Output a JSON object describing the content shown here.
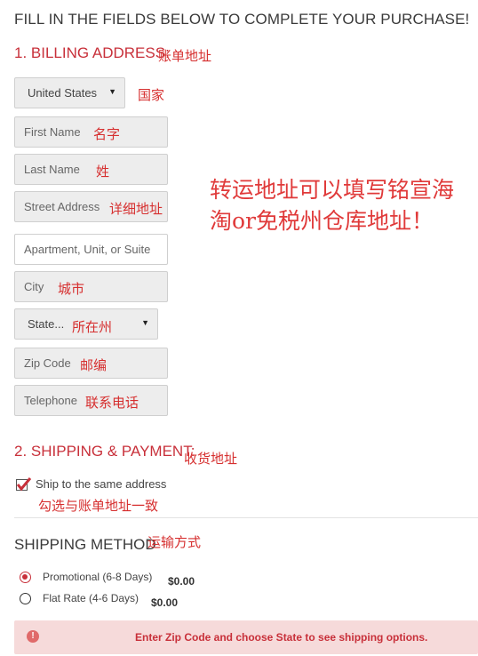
{
  "header": {
    "title": "FILL IN THE FIELDS BELOW TO COMPLETE YOUR PURCHASE!"
  },
  "billing": {
    "heading": "1. BILLING ADDRESS:",
    "note": "账单地址",
    "country": {
      "value": "United States",
      "note": "国家"
    },
    "first_name": {
      "placeholder": "First Name",
      "note": "名字"
    },
    "last_name": {
      "placeholder": "Last Name",
      "note": "姓"
    },
    "street": {
      "placeholder": "Street Address",
      "note": "详细地址"
    },
    "apartment": {
      "placeholder": "Apartment, Unit, or Suite"
    },
    "city": {
      "placeholder": "City",
      "note": "城市"
    },
    "state": {
      "value": "State...",
      "note": "所在州"
    },
    "zip": {
      "placeholder": "Zip Code",
      "note": "邮编"
    },
    "telephone": {
      "placeholder": "Telephone",
      "note": "联系电话"
    }
  },
  "annotation": {
    "text": "转运地址可以填写铭宣海淘or免税州仓库地址！"
  },
  "shipping_payment": {
    "heading": "2. SHIPPING & PAYMENT:",
    "note": "收货地址",
    "same_address": {
      "label": "Ship to the same address",
      "checked": true,
      "note": "勾选与账单地址一致"
    }
  },
  "shipping_method": {
    "heading": "SHIPPING METHOD",
    "note": "运输方式",
    "options": [
      {
        "label": "Promotional (6-8 Days)",
        "price": "$0.00",
        "selected": true
      },
      {
        "label": "Flat Rate (4-6 Days)",
        "price": "$0.00",
        "selected": false
      }
    ]
  },
  "alert": {
    "icon": "exclamation-icon",
    "text": "Enter Zip Code and choose State to see shipping options."
  },
  "colors": {
    "accent": "#c8303a",
    "note": "#d62f2f",
    "alert_bg": "#f6dada"
  }
}
